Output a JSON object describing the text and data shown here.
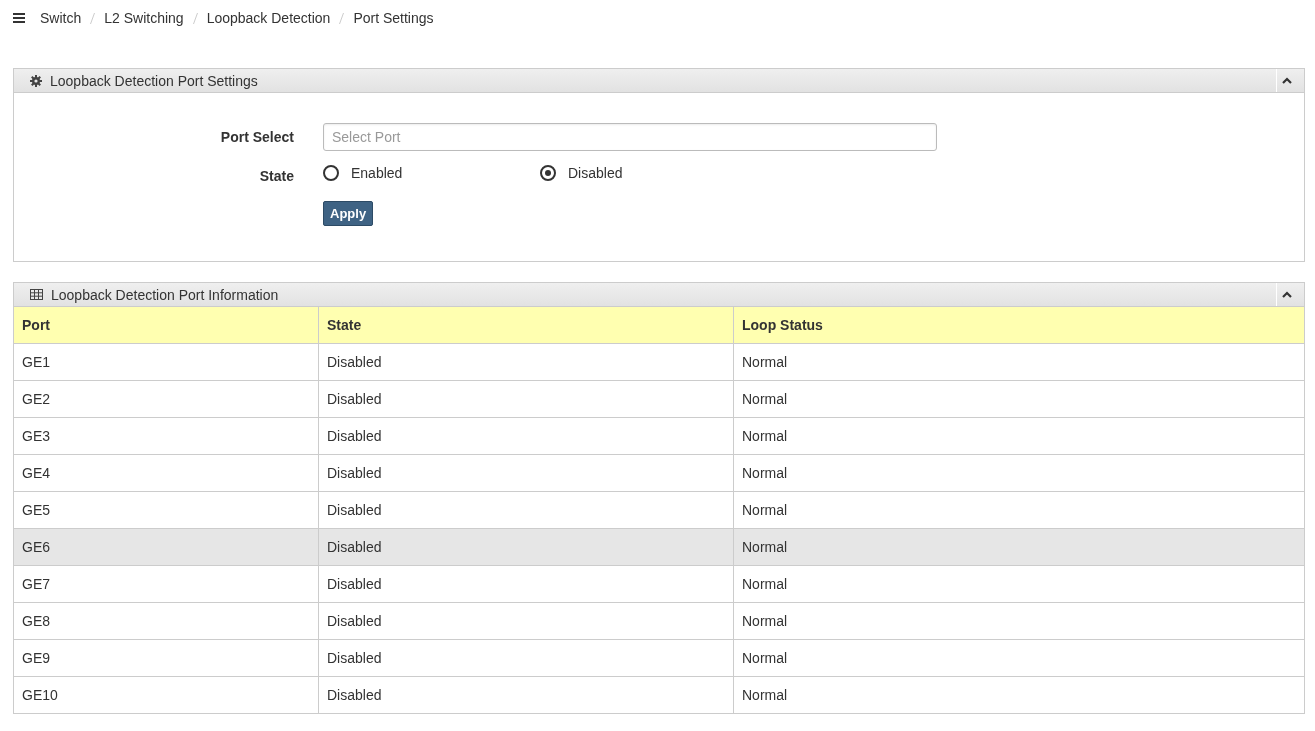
{
  "breadcrumb": [
    "Switch",
    "L2 Switching",
    "Loopback Detection",
    "Port Settings"
  ],
  "settings_panel": {
    "title": "Loopback Detection Port Settings",
    "port_select": {
      "label": "Port Select",
      "placeholder": "Select Port"
    },
    "state": {
      "label": "State",
      "options": [
        {
          "label": "Enabled",
          "selected": false
        },
        {
          "label": "Disabled",
          "selected": true
        }
      ]
    },
    "apply_button": "Apply"
  },
  "info_panel": {
    "title": "Loopback Detection Port Information",
    "table": {
      "columns": [
        "Port",
        "State",
        "Loop Status"
      ],
      "rows": [
        {
          "cells": [
            "GE1",
            "Disabled",
            "Normal"
          ],
          "selected": false
        },
        {
          "cells": [
            "GE2",
            "Disabled",
            "Normal"
          ],
          "selected": false
        },
        {
          "cells": [
            "GE3",
            "Disabled",
            "Normal"
          ],
          "selected": false
        },
        {
          "cells": [
            "GE4",
            "Disabled",
            "Normal"
          ],
          "selected": false
        },
        {
          "cells": [
            "GE5",
            "Disabled",
            "Normal"
          ],
          "selected": false
        },
        {
          "cells": [
            "GE6",
            "Disabled",
            "Normal"
          ],
          "selected": true
        },
        {
          "cells": [
            "GE7",
            "Disabled",
            "Normal"
          ],
          "selected": false
        },
        {
          "cells": [
            "GE8",
            "Disabled",
            "Normal"
          ],
          "selected": false
        },
        {
          "cells": [
            "GE9",
            "Disabled",
            "Normal"
          ],
          "selected": false
        },
        {
          "cells": [
            "GE10",
            "Disabled",
            "Normal"
          ],
          "selected": false
        }
      ]
    }
  }
}
